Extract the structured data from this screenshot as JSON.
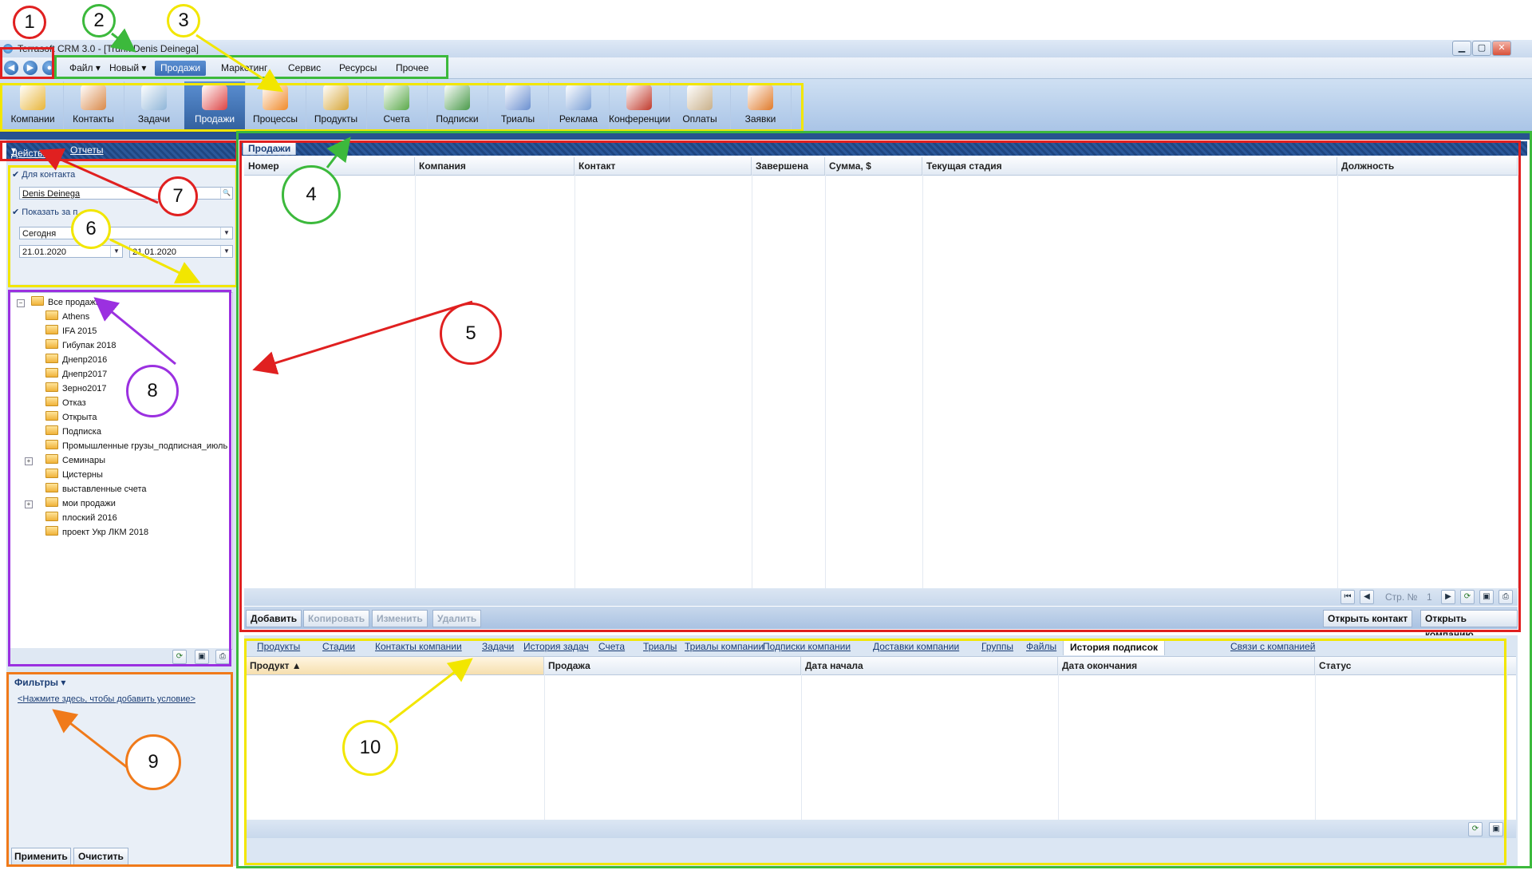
{
  "window": {
    "title": "Terrasoft CRM 3.0 - [Trunk Denis Deinega]"
  },
  "menu": {
    "items": [
      {
        "label": "Файл",
        "dropdown": true
      },
      {
        "label": "Новый",
        "dropdown": true
      },
      {
        "label": "Продажи",
        "active": true
      },
      {
        "label": "Маркетинг"
      },
      {
        "label": "Сервис"
      },
      {
        "label": "Ресурсы"
      },
      {
        "label": "Прочее"
      }
    ]
  },
  "toolbar": {
    "items": [
      {
        "label": "Компании",
        "icon": "building-icon",
        "color": "#e8b53a"
      },
      {
        "label": "Контакты",
        "icon": "people-icon",
        "color": "#d9894a"
      },
      {
        "label": "Задачи",
        "icon": "stopwatch-icon",
        "color": "#8fb5d8"
      },
      {
        "label": "Продажи",
        "icon": "sales-chart-icon",
        "color": "#d44",
        "active": true
      },
      {
        "label": "Процессы",
        "icon": "gears-icon",
        "color": "#f08a2a"
      },
      {
        "label": "Продукты",
        "icon": "box-icon",
        "color": "#d6a536"
      },
      {
        "label": "Счета",
        "icon": "invoice-dollar-icon",
        "color": "#5ba94a"
      },
      {
        "label": "Подписки",
        "icon": "subscription-people-icon",
        "color": "#4a9a4a"
      },
      {
        "label": "Триалы",
        "icon": "trial-people-icon",
        "color": "#6a8fd0"
      },
      {
        "label": "Реклама",
        "icon": "advertising-icon",
        "color": "#7a9fd6"
      },
      {
        "label": "Конференции",
        "icon": "speaker-icon",
        "color": "#c0392b"
      },
      {
        "label": "Оплаты",
        "icon": "money-bag-icon",
        "color": "#c9b08a"
      },
      {
        "label": "Заявки",
        "icon": "notepad-icon",
        "color": "#e07a2a"
      }
    ]
  },
  "left": {
    "actions_label": "Действия",
    "reports_label": "Отчеты",
    "for_contact_label": "Для контакта",
    "contact_value": "Denis Deinega",
    "show_for_period_label": "Показать за п",
    "period_value": "Сегодня",
    "date_from": "21.01.2020",
    "date_to": "21.01.2020",
    "tree": {
      "root": "Все продажи",
      "items": [
        "Athens",
        "IFA 2015",
        "Гибупак 2018",
        "Днепр2016",
        "Днепр2017",
        "Зерно2017",
        "Отказ",
        "Открыта",
        "Подписка",
        "Промышленные грузы_подписная_июль",
        "Семинары",
        "Цистерны",
        "выставленные счета",
        "мои продажи",
        "плоский 2016",
        "проект Укр ЛКМ 2018"
      ]
    },
    "filters_label": "Фильтры",
    "add_condition_link": "<Нажмите здесь, чтобы добавить условие>",
    "apply_label": "Применить",
    "clear_label": "Очистить"
  },
  "main": {
    "tab_label": "Продажи",
    "columns": [
      "Номер",
      "Компания",
      "Контакт",
      "Завершена",
      "Сумма, $",
      "Текущая стадия",
      "Должность"
    ],
    "page_label": "Стр. №",
    "page_number": "1",
    "buttons": {
      "add": "Добавить",
      "copy": "Копировать",
      "edit": "Изменить",
      "delete": "Удалить",
      "open_contact": "Открыть контакт",
      "open_company": "Открыть компанию"
    }
  },
  "detail": {
    "tabs": [
      "Продукты",
      "Стадии",
      "Контакты компании",
      "Задачи",
      "История задач",
      "Счета",
      "Триалы",
      "Триалы компании",
      "Подписки компании",
      "Доставки компании",
      "Группы",
      "Файлы",
      "История подписок",
      "Связи с компанией"
    ],
    "active_tab": "История подписок",
    "columns": [
      "Продукт",
      "Продажа",
      "Дата начала",
      "Дата окончания",
      "Статус"
    ]
  },
  "annotations": {
    "labels": [
      "1",
      "2",
      "3",
      "4",
      "5",
      "6",
      "7",
      "8",
      "9",
      "10"
    ],
    "colors": {
      "red": "#e02020",
      "green": "#3cb93c",
      "yellow": "#f2e600",
      "purple": "#9b30e0",
      "orange": "#f07a1a"
    }
  }
}
